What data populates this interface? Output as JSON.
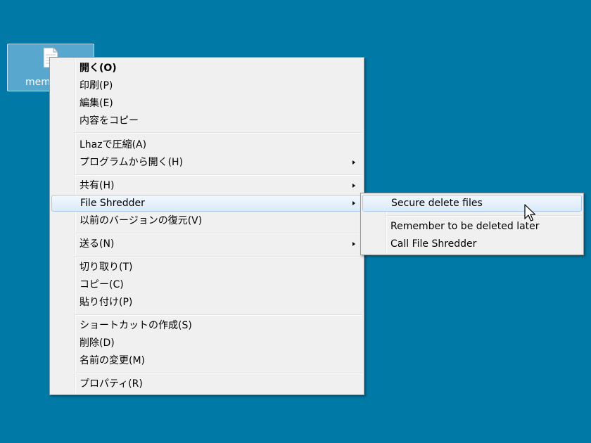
{
  "desktop": {
    "icon_label": "memo",
    "icon": "text-file-icon"
  },
  "context_menu": {
    "items": [
      {
        "label": "開く(O)",
        "bold": true,
        "submenu": false
      },
      {
        "label": "印刷(P)",
        "submenu": false
      },
      {
        "label": "編集(E)",
        "submenu": false
      },
      {
        "label": "内容をコピー",
        "submenu": false
      },
      {
        "label": "Lhazで圧縮(A)",
        "submenu": false
      },
      {
        "label": "プログラムから開く(H)",
        "submenu": true
      },
      {
        "label": "共有(H)",
        "submenu": true
      },
      {
        "label": "File Shredder",
        "submenu": true,
        "highlighted": true
      },
      {
        "label": "以前のバージョンの復元(V)",
        "submenu": false
      },
      {
        "label": "送る(N)",
        "submenu": true
      },
      {
        "label": "切り取り(T)",
        "submenu": false
      },
      {
        "label": "コピー(C)",
        "submenu": false
      },
      {
        "label": "貼り付け(P)",
        "submenu": false
      },
      {
        "label": "ショートカットの作成(S)",
        "submenu": false
      },
      {
        "label": "削除(D)",
        "submenu": false
      },
      {
        "label": "名前の変更(M)",
        "submenu": false
      },
      {
        "label": "プロパティ(R)",
        "submenu": false
      }
    ]
  },
  "submenu": {
    "items": [
      {
        "label": "Secure delete files",
        "highlighted": true
      },
      {
        "label": "Remember to be deleted later"
      },
      {
        "label": "Call File Shredder"
      }
    ]
  },
  "colors": {
    "desktop_background": "#0079a6",
    "menu_background": "#f0f0f0",
    "highlight_border": "#a8cbee"
  },
  "cursor": "arrow-cursor-icon"
}
